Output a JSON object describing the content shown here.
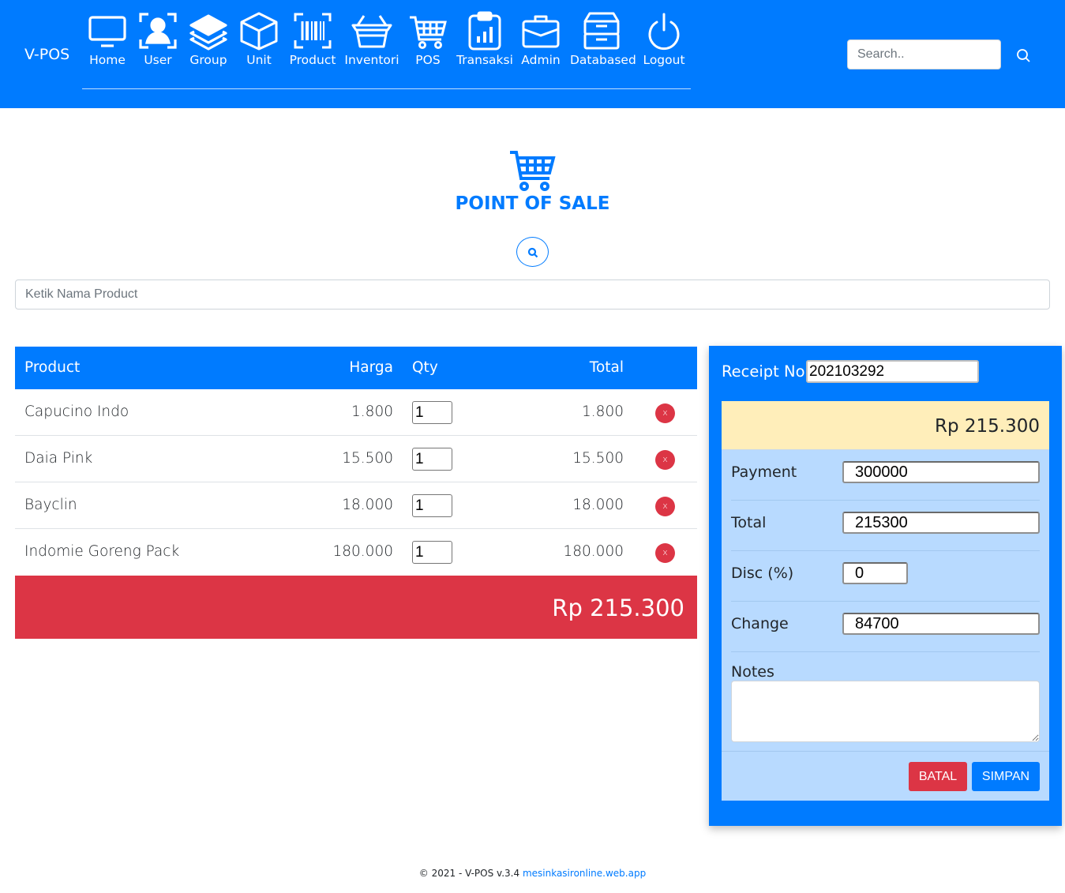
{
  "brand": "V-POS",
  "nav": [
    {
      "label": "Home",
      "icon": "monitor-icon"
    },
    {
      "label": "User",
      "icon": "user-scan-icon"
    },
    {
      "label": "Group",
      "icon": "layers-icon"
    },
    {
      "label": "Unit",
      "icon": "box-icon"
    },
    {
      "label": "Product",
      "icon": "barcode-icon"
    },
    {
      "label": "Inventori",
      "icon": "basket-icon"
    },
    {
      "label": "POS",
      "icon": "cart-icon"
    },
    {
      "label": "Transaksi",
      "icon": "clipboard-chart-icon"
    },
    {
      "label": "Admin",
      "icon": "briefcase-icon"
    },
    {
      "label": "Databased",
      "icon": "archive-icon"
    },
    {
      "label": "Logout",
      "icon": "power-icon"
    }
  ],
  "search": {
    "placeholder": "Search.."
  },
  "page": {
    "title": "POINT OF SALE",
    "product_placeholder": "Ketik Nama Product"
  },
  "cart": {
    "headers": {
      "product": "Product",
      "price": "Harga",
      "qty": "Qty",
      "total": "Total"
    },
    "rows": [
      {
        "name": "Capucino Indo",
        "price": "1.800",
        "qty": "1",
        "total": "1.800",
        "remove": "x"
      },
      {
        "name": "Daia Pink",
        "price": "15.500",
        "qty": "1",
        "total": "15.500",
        "remove": "x"
      },
      {
        "name": "Bayclin",
        "price": "18.000",
        "qty": "1",
        "total": "18.000",
        "remove": "x"
      },
      {
        "name": "Indomie Goreng Pack",
        "price": "180.000",
        "qty": "1",
        "total": "180.000",
        "remove": "x"
      }
    ],
    "grand_total": "Rp 215.300"
  },
  "checkout": {
    "receipt_label": "Receipt No.",
    "receipt_no": "202103292",
    "summary_total": "Rp 215.300",
    "payment_label": "Payment",
    "payment": "300000",
    "total_label": "Total",
    "total": "215300",
    "disc_label": "Disc (%)",
    "disc": "0",
    "change_label": "Change",
    "change": "84700",
    "notes_label": "Notes",
    "notes": "",
    "cancel_label": "BATAL",
    "save_label": "SIMPAN"
  },
  "footer": {
    "text": "© 2021 - V-POS v.3.4",
    "link": "mesinkasironline.web.app"
  },
  "colors": {
    "primary": "#007bff",
    "danger": "#dc3545",
    "summary_bg": "#ffeeba",
    "form_bg": "#b8daff"
  }
}
